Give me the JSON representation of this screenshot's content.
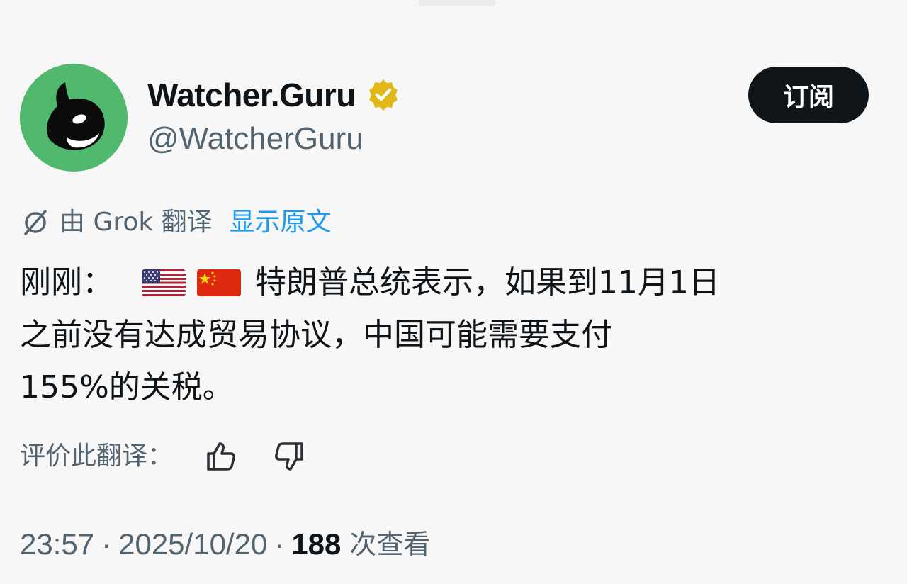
{
  "account": {
    "display_name": "Watcher.Guru",
    "handle": "@WatcherGuru",
    "verified_badge": "gold-check-badge-icon",
    "avatar_icon": "orca-whale-icon",
    "avatar_color": "#50b96e"
  },
  "subscribe_label": "订阅",
  "translation": {
    "icon": "grok-icon",
    "translated_by": "由 Grok 翻译",
    "show_original": "显示原文",
    "link_color": "#1d9bf0"
  },
  "tweet": {
    "prefix": "刚刚：",
    "flags": [
      "us-flag-icon",
      "china-flag-icon"
    ],
    "line1_rest": "特朗普总统表示，如果到11月1日",
    "line2": "之前没有达成贸易协议，中国可能需要支付",
    "line3": "155%的关税。"
  },
  "rating": {
    "label": "评价此翻译：",
    "thumbs_up_icon": "thumbs-up-icon",
    "thumbs_down_icon": "thumbs-down-icon"
  },
  "meta": {
    "time": "23:57",
    "separator": "·",
    "date": "2025/10/20",
    "views_count": "188",
    "views_label": "次查看"
  }
}
